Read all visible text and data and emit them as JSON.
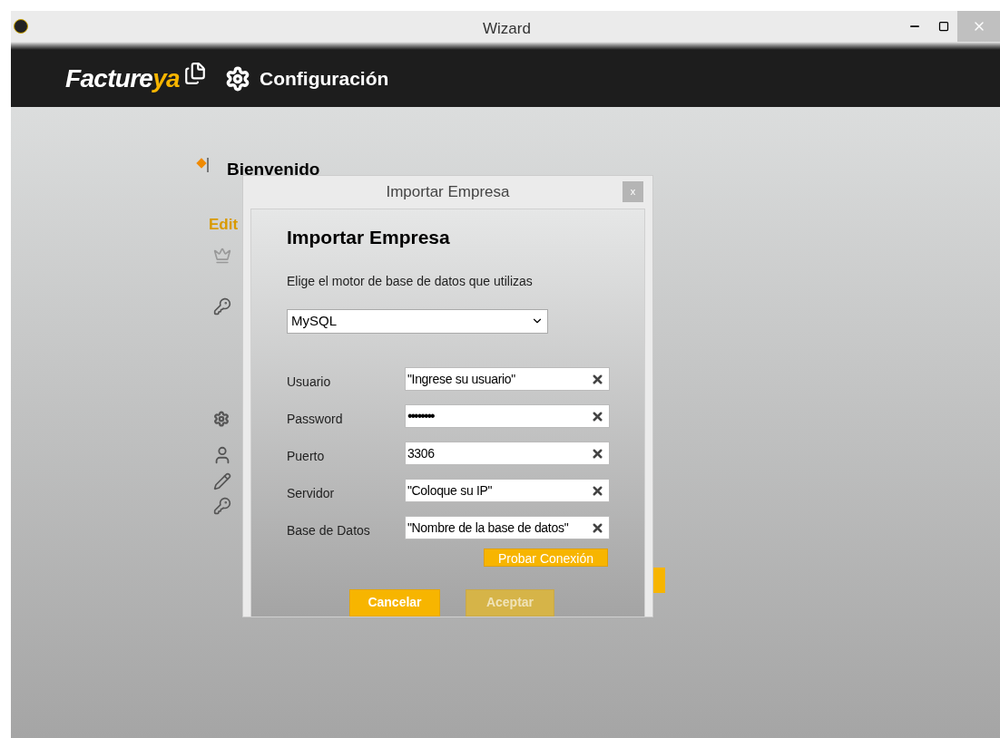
{
  "window": {
    "title": "Wizard"
  },
  "header": {
    "brand": "Facture",
    "brand_accent": "ya",
    "section": "Configuración"
  },
  "background": {
    "welcome": "Bienvenido",
    "edit_label": "Edit"
  },
  "dialog": {
    "title": "Importar Empresa",
    "close": "x",
    "heading": "Importar Empresa",
    "prompt": "Elige el motor de base de datos que utilizas",
    "engine": {
      "value": "MySQL"
    },
    "fields": [
      {
        "label": "Usuario",
        "value": "\"Ingrese su usuario\"",
        "kind": "text"
      },
      {
        "label": "Password",
        "value": "••••••••",
        "kind": "password"
      },
      {
        "label": "Puerto",
        "value": "3306",
        "kind": "text"
      },
      {
        "label": "Servidor",
        "value": "\"Coloque su IP\"",
        "kind": "text"
      },
      {
        "label": "Base de Datos",
        "value": "\"Nombre de la base de datos\"",
        "kind": "text"
      }
    ],
    "test_button": "Probar Conexión",
    "buttons": [
      {
        "label": "Cancelar",
        "disabled": false
      },
      {
        "label": "Aceptar",
        "disabled": true
      }
    ]
  }
}
